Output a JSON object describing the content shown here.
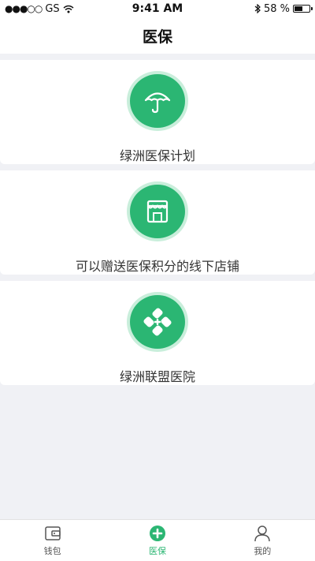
{
  "status_bar": {
    "carrier": "GS",
    "signal_dots": "●●●○○",
    "time": "9:41 AM",
    "battery_percent_text": "58 %",
    "battery_level": 0.58
  },
  "nav": {
    "title": "医保"
  },
  "cards": [
    {
      "label": "绿洲医保计划",
      "icon": "umbrella-icon"
    },
    {
      "label": "可以赠送医保积分的线下店铺",
      "icon": "store-icon"
    },
    {
      "label": "绿洲联盟医院",
      "icon": "medical-cross-icon"
    }
  ],
  "tabs": [
    {
      "label": "钱包",
      "icon": "wallet-icon",
      "active": false
    },
    {
      "label": "医保",
      "icon": "medical-plus-icon",
      "active": true
    },
    {
      "label": "我的",
      "icon": "user-icon",
      "active": false
    }
  ],
  "colors": {
    "accent": "#2bb673",
    "accent_ring": "#c9eedb",
    "background": "#f0f1f5"
  }
}
